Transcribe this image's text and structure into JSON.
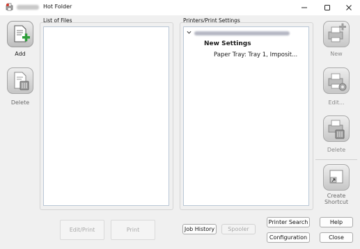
{
  "window": {
    "title": "Hot Folder",
    "controls": {
      "minimize": "minimize",
      "maximize": "maximize",
      "close": "close"
    }
  },
  "left_toolbar": {
    "add_label": "Add",
    "delete_label": "Delete"
  },
  "files_panel": {
    "label": "List of Files",
    "items": []
  },
  "printers_panel": {
    "label": "Printers/Print Settings",
    "tree": {
      "setting_name": "New Settings",
      "setting_detail": "Paper Tray: Tray 1, Imposit..."
    }
  },
  "right_toolbar": {
    "new_label": "New",
    "edit_label": "Edit...",
    "delete_label": "Delete",
    "create_shortcut_label": "Create\nShortcut"
  },
  "bottom_buttons": {
    "edit_print": "Edit/Print",
    "print": "Print",
    "job_history": "Job History",
    "spooler": "Spooler",
    "printer_search": "Printer Search",
    "configuration": "Configuration",
    "help": "Help",
    "close": "Close"
  },
  "colors": {
    "window_bg": "#f0f0f0",
    "list_bg": "#ffffff",
    "add_plus": "#2e9e3a",
    "disabled_text": "#a8a8a8"
  }
}
